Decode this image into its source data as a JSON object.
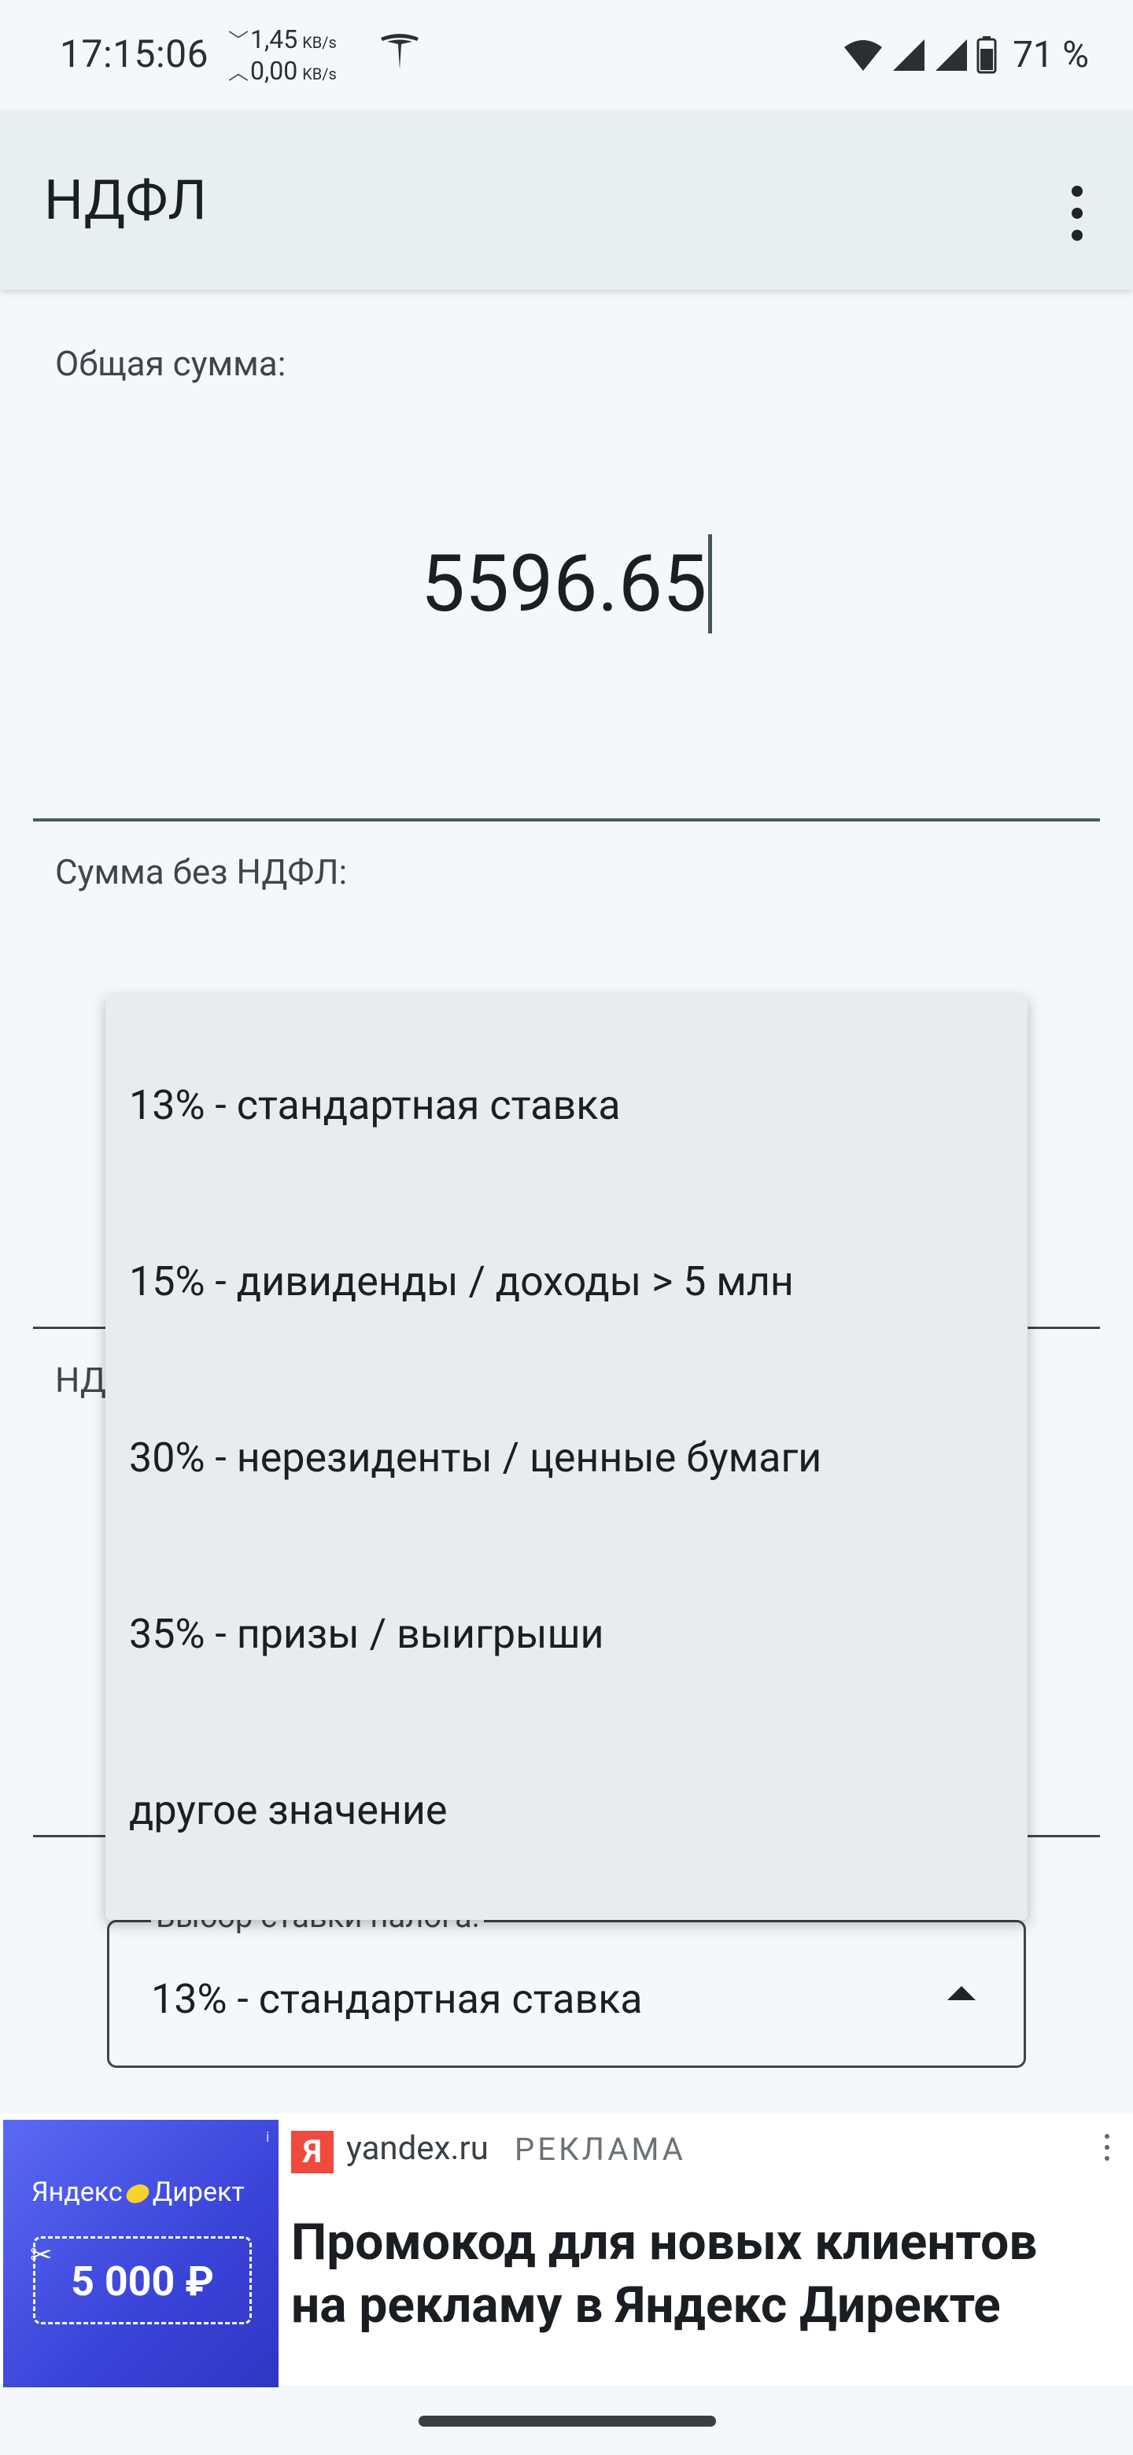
{
  "status_bar": {
    "time": "17:15:06",
    "download_speed": "1,45",
    "upload_speed": "0,00",
    "speed_unit": "KB/s",
    "battery_percent": "71 %"
  },
  "app_bar": {
    "title": "НДФЛ"
  },
  "fields": {
    "total_label": "Общая сумма:",
    "total_value": "5596.65",
    "net_label": "Сумма без НДФЛ:",
    "tax_label_partial": "НД"
  },
  "tax_rate_select": {
    "legend": "Выбор ставки налога:",
    "selected": "13% - стандартная ставка",
    "options": [
      "13% - стандартная ставка",
      "15% - дивиденды / доходы > 5 млн",
      "30% - нерезиденты / ценные бумаги",
      "35% - призы / выигрыши",
      "другое значение"
    ]
  },
  "ad": {
    "brand_left": "Яндекс",
    "brand_right": "Директ",
    "coupon": "5 000 ₽",
    "info_mark": "i",
    "badge": "Я",
    "domain": "yandex.ru",
    "tag": "РЕКЛАМА",
    "headline_line1": "Промокод для новых клиентов",
    "headline_line2": "на рекламу в Яндекс Директе"
  },
  "colors": {
    "background": "#f4f8fb",
    "app_bar": "#e9eef1",
    "menu": "#e9ecef",
    "underline": "#475a63",
    "ad_gradient": "#3a44d8",
    "yandex_red": "#f04a3e"
  }
}
